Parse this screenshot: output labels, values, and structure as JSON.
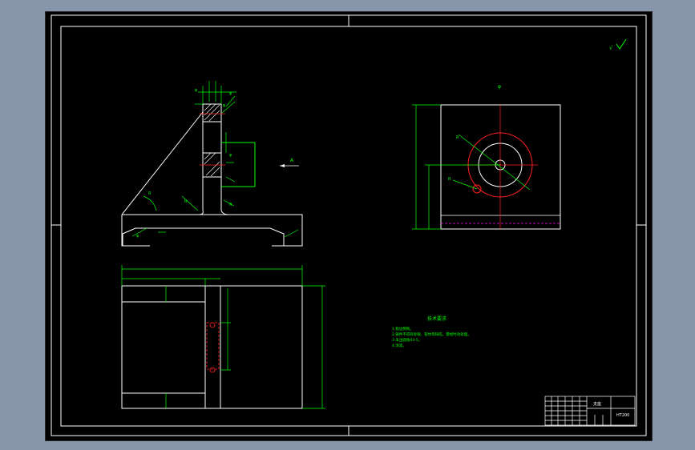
{
  "viewport": {
    "background": "#000000",
    "frame_color": "#ffffff",
    "dim_color": "#00ff00",
    "center_color": "#ff2020",
    "hidden_color": "#ff00ff"
  },
  "roughness_symbol": "√",
  "front_view": {
    "dims": [
      "φ",
      "φ",
      "φ",
      "φ",
      "R",
      "R",
      "R",
      "φ"
    ]
  },
  "side_view": {
    "label": "A"
  },
  "top_view": {
    "dims": [
      "φ",
      "R",
      "R"
    ]
  },
  "notes": {
    "title": "技术要求",
    "lines": [
      "1.锐边倒钝。",
      "2.铸件不得有砂眼、裂纹等缺陷，需经时效处理。",
      "3.未注圆角R3-5。",
      "4.涂漆。"
    ]
  },
  "title_block": {
    "name": "支座",
    "material": "HT200"
  }
}
